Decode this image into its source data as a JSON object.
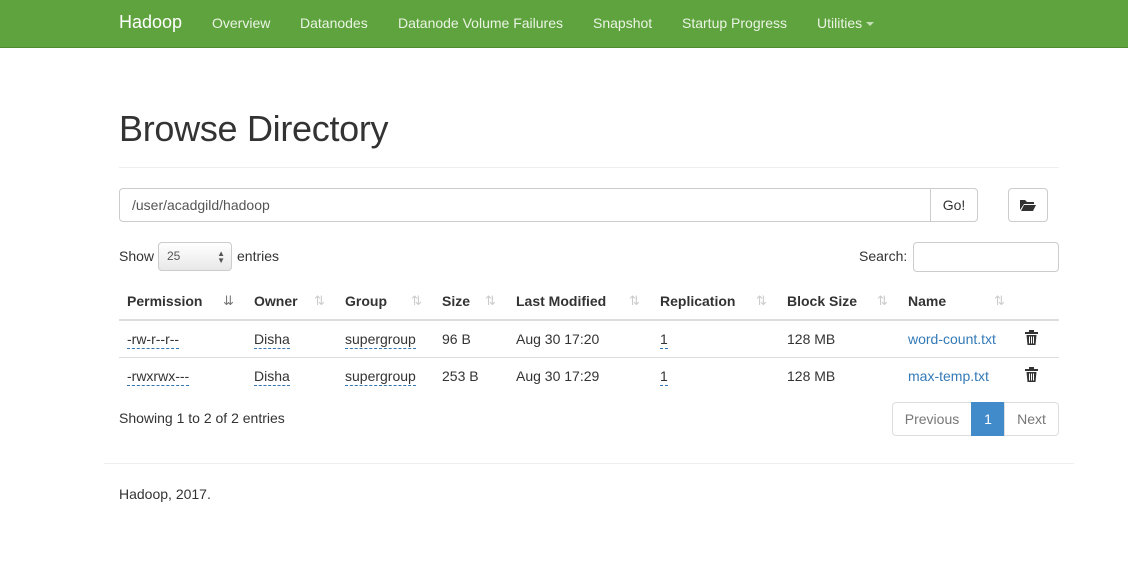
{
  "navbar": {
    "brand": "Hadoop",
    "items": [
      {
        "label": "Overview"
      },
      {
        "label": "Datanodes"
      },
      {
        "label": "Datanode Volume Failures"
      },
      {
        "label": "Snapshot"
      },
      {
        "label": "Startup Progress"
      },
      {
        "label": "Utilities"
      }
    ]
  },
  "page": {
    "title": "Browse Directory"
  },
  "path": {
    "value": "/user/acadgild/hadoop",
    "go_label": "Go!"
  },
  "controls": {
    "show_label": "Show",
    "entries_value": "25",
    "entries_label": "entries",
    "search_label": "Search:"
  },
  "table": {
    "columns": [
      "Permission",
      "Owner",
      "Group",
      "Size",
      "Last Modified",
      "Replication",
      "Block Size",
      "Name"
    ],
    "rows": [
      {
        "permission": "-rw-r--r--",
        "owner": "Disha",
        "group": "supergroup",
        "size": "96 B",
        "modified": "Aug 30 17:20",
        "replication": "1",
        "block_size": "128 MB",
        "name": "word-count.txt"
      },
      {
        "permission": "-rwxrwx---",
        "owner": "Disha",
        "group": "supergroup",
        "size": "253 B",
        "modified": "Aug 30 17:29",
        "replication": "1",
        "block_size": "128 MB",
        "name": "max-temp.txt"
      }
    ]
  },
  "pagination": {
    "info": "Showing 1 to 2 of 2 entries",
    "previous": "Previous",
    "current_page": "1",
    "next": "Next"
  },
  "footer": {
    "text": "Hadoop, 2017."
  },
  "colors": {
    "navbar": "#5fa33e",
    "link": "#337ab7",
    "active_page": "#428bca"
  }
}
